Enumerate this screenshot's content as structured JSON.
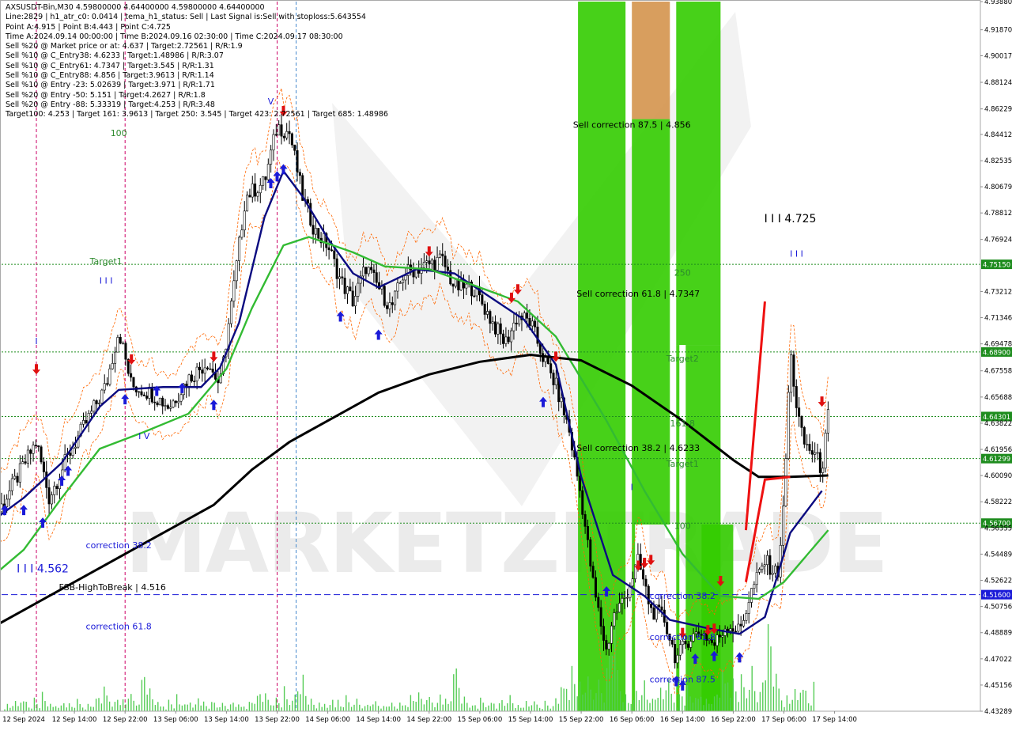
{
  "header": {
    "lines": [
      "AXSUSDT-Bin,M30  4.59800000 4.64400000 4.59800000 4.64400000",
      "Line:2829  |  h1_atr_c0: 0.0414  |  tema_h1_status: Sell  |  Last Signal is:Sell with stoploss:5.643554",
      "Point A:4.915  |  Point B:4.443  |  Point C:4.725",
      "Time A:2024.09.14 00:00:00  |  Time B:2024.09.16 02:30:00  |  Time C:2024.09.17 08:30:00",
      "Sell %20 @ Market price or at: 4.637  |  Target:2.72561  |  R/R:1.9",
      "Sell %10 @ C_Entry38: 4.6233  |  Target:1.48986  |  R/R:3.07",
      "Sell %10 @ C_Entry61: 4.7347  |  Target:3.545  |  R/R:1.31",
      "Sell %10 @ C_Entry88: 4.856  |  Target:3.9613  |  R/R:1.14",
      "Sell %10 @ Entry -23: 5.02639  |  Target:3.971  |  R/R:1.71",
      "Sell %20 @ Entry -50: 5.151  |  Target:4.2627  |  R/R:1.8",
      "Sell %20 @ Entry -88: 5.33319  |  Target:4.253  |  R/R:3.48",
      "Target100: 4.253  |  Target 161: 3.9613  |  Target 250: 3.545  |  Target 423: 2.72561  |  Target 685: 1.48986"
    ]
  },
  "chart_data": {
    "type": "candlestick",
    "symbol": "AXSUSDT-Bin",
    "timeframe": "M30",
    "ylim": [
      4.4329,
      4.9388
    ],
    "y_ticks": [
      "4.93880",
      "4.91870",
      "4.90017",
      "4.88124",
      "4.86229",
      "4.84412",
      "4.82535",
      "4.80679",
      "4.78812",
      "4.76924",
      "4.75150",
      "4.73212",
      "4.71346",
      "4.69478",
      "4.68900",
      "4.67558",
      "4.65688",
      "4.64301",
      "4.63822",
      "4.61956",
      "4.61299",
      "4.60090",
      "4.58222",
      "4.56700",
      "4.56355",
      "4.54489",
      "4.52622",
      "4.51600",
      "4.50756",
      "4.48889",
      "4.47022",
      "4.45156",
      "4.43289"
    ],
    "x_ticks": [
      "12 Sep 2024",
      "12 Sep 14:00",
      "12 Sep 22:00",
      "13 Sep 06:00",
      "13 Sep 14:00",
      "13 Sep 22:00",
      "14 Sep 06:00",
      "14 Sep 14:00",
      "14 Sep 22:00",
      "15 Sep 06:00",
      "15 Sep 14:00",
      "15 Sep 22:00",
      "16 Sep 06:00",
      "16 Sep 14:00",
      "16 Sep 22:00",
      "17 Sep 06:00",
      "17 Sep 14:00"
    ],
    "level_lines": [
      {
        "value": 4.7515,
        "label": "4.75150",
        "color": "#1e8c1e",
        "style": "dotted"
      },
      {
        "value": 4.689,
        "label": "4.68900",
        "color": "#1e8c1e",
        "style": "dotted"
      },
      {
        "value": 4.643,
        "label": "4.64301",
        "color": "#1e8c1e",
        "style": "dotted"
      },
      {
        "value": 4.613,
        "label": "4.61299",
        "color": "#1e8c1e",
        "style": "dotted"
      },
      {
        "value": 4.567,
        "label": "4.56700",
        "color": "#1e8c1e",
        "style": "dotted"
      },
      {
        "value": 4.516,
        "label": "4.51600",
        "color": "#1a1ad8",
        "style": "dashed"
      }
    ],
    "annotations": [
      {
        "text": "100",
        "x": "12 Sep 21:00",
        "y": 4.843,
        "color": "#2d8a2d"
      },
      {
        "text": "Target1",
        "x": "12 Sep 19:00",
        "y": 4.7516,
        "color": "#2d8a2d"
      },
      {
        "text": "I I I",
        "x": "12 Sep 19:00",
        "y": 4.7376,
        "color": "#1a1ad8"
      },
      {
        "text": "V",
        "x": "13 Sep 21:00",
        "y": 4.8655,
        "color": "#1a1ad8"
      },
      {
        "text": "I",
        "x": "12 Sep 08:00",
        "y": 4.6946,
        "color": "#1a1ad8"
      },
      {
        "text": "I V",
        "x": "13 Sep 01:00",
        "y": 4.6268,
        "color": "#1a1ad8"
      },
      {
        "text": "correction 38.2",
        "x": "12 Sep 21:00",
        "y": 4.549,
        "color": "#1a1ad8"
      },
      {
        "text": "I I I 4.562",
        "x": "12 Sep 09:00",
        "y": 4.5319,
        "color": "#1a1ad8"
      },
      {
        "text": "FSB-HighToBreak  |  4.516",
        "x": "12 Sep 20:00",
        "y": 4.5191,
        "color": "#000000"
      },
      {
        "text": "correction 61.8",
        "x": "12 Sep 21:00",
        "y": 4.4913,
        "color": "#1a1ad8"
      },
      {
        "text": "Sell correction 87.5 | 4.856",
        "x": "16 Sep 06:00",
        "y": 4.8489,
        "color": "#000000"
      },
      {
        "text": "Sell correction 61.8 | 4.7347",
        "x": "16 Sep 07:00",
        "y": 4.7283,
        "color": "#000000"
      },
      {
        "text": "Sell correction 38.2 | 4.6233",
        "x": "16 Sep 07:00",
        "y": 4.6184,
        "color": "#000000"
      },
      {
        "text": "I I I 4.725",
        "x": "17 Sep 07:00",
        "y": 4.7814,
        "color": "#000000"
      },
      {
        "text": "I I I",
        "x": "17 Sep 08:00",
        "y": 4.7569,
        "color": "#1a1ad8"
      },
      {
        "text": "250",
        "x": "16 Sep 14:00",
        "y": 4.7435,
        "color": "#2d8a2d"
      },
      {
        "text": "Target2",
        "x": "16 Sep 14:00",
        "y": 4.6821,
        "color": "#2d8a2d"
      },
      {
        "text": "161.8",
        "x": "16 Sep 14:00",
        "y": 4.636,
        "color": "#2d8a2d"
      },
      {
        "text": "Target1",
        "x": "16 Sep 14:00",
        "y": 4.6072,
        "color": "#2d8a2d"
      },
      {
        "text": "I",
        "x": "16 Sep 06:00",
        "y": 4.5906,
        "color": "#1a1ad8"
      },
      {
        "text": "100",
        "x": "16 Sep 14:00",
        "y": 4.5628,
        "color": "#2d8a2d"
      },
      {
        "text": "correction 38.2",
        "x": "16 Sep 14:00",
        "y": 4.5129,
        "color": "#1a1ad8"
      },
      {
        "text": "correction 61.8",
        "x": "16 Sep 14:00",
        "y": 4.4837,
        "color": "#1a1ad8"
      },
      {
        "text": "correction 87.5",
        "x": "16 Sep 14:00",
        "y": 4.4535,
        "color": "#1a1ad8"
      }
    ],
    "zones": [
      {
        "from": "15 Sep 21:30",
        "to": "16 Sep 05:00",
        "y0": 4.4329,
        "y1": 4.9388,
        "color": "#33cc00"
      },
      {
        "from": "16 Sep 06:00",
        "to": "16 Sep 12:00",
        "y0": 4.855,
        "y1": 4.9388,
        "color": "#d4944c"
      },
      {
        "from": "16 Sep 06:00",
        "to": "16 Sep 12:00",
        "y0": 4.566,
        "y1": 4.855,
        "color": "#33cc00"
      },
      {
        "from": "16 Sep 13:00",
        "to": "16 Sep 20:00",
        "y0": 4.694,
        "y1": 4.9388,
        "color": "#33cc00"
      },
      {
        "from": "16 Sep 13:00",
        "to": "16 Sep 13:30",
        "y0": 4.4329,
        "y1": 4.694,
        "color": "#33cc00"
      },
      {
        "from": "16 Sep 14:30",
        "to": "16 Sep 20:00",
        "y0": 4.4329,
        "y1": 4.694,
        "color": "#33cc00"
      },
      {
        "from": "16 Sep 06:00",
        "to": "16 Sep 06:30",
        "y0": 4.4329,
        "y1": 4.566,
        "color": "#33cc00"
      },
      {
        "from": "16 Sep 17:00",
        "to": "16 Sep 22:00",
        "y0": 4.4329,
        "y1": 4.566,
        "color": "#33cc00"
      }
    ],
    "series": [
      {
        "name": "",
        "color": "#0a0a80",
        "values": [
          [
            "12 Sep 00:00",
            4.565
          ],
          [
            "12 Sep 06:00",
            4.585
          ],
          [
            "12 Sep 12:00",
            4.61
          ],
          [
            "12 Sep 18:00",
            4.65
          ],
          [
            "12 Sep 21:00",
            4.662
          ],
          [
            "13 Sep 04:00",
            4.664
          ],
          [
            "13 Sep 10:00",
            4.664
          ],
          [
            "13 Sep 13:00",
            4.678
          ],
          [
            "13 Sep 16:00",
            4.71
          ],
          [
            "13 Sep 20:00",
            4.785
          ],
          [
            "13 Sep 23:00",
            4.818
          ],
          [
            "14 Sep 02:00",
            4.8
          ],
          [
            "14 Sep 06:00",
            4.77
          ],
          [
            "14 Sep 10:00",
            4.745
          ],
          [
            "14 Sep 14:00",
            4.735
          ],
          [
            "14 Sep 20:00",
            4.748
          ],
          [
            "15 Sep 02:00",
            4.745
          ],
          [
            "15 Sep 08:00",
            4.727
          ],
          [
            "15 Sep 13:00",
            4.712
          ],
          [
            "15 Sep 18:00",
            4.68
          ],
          [
            "15 Sep 22:00",
            4.6
          ],
          [
            "16 Sep 03:00",
            4.53
          ],
          [
            "16 Sep 08:00",
            4.515
          ],
          [
            "16 Sep 12:00",
            4.498
          ],
          [
            "16 Sep 18:00",
            4.492
          ],
          [
            "16 Sep 23:00",
            4.488
          ],
          [
            "17 Sep 03:00",
            4.5
          ],
          [
            "17 Sep 07:00",
            4.56
          ],
          [
            "17 Sep 12:00",
            4.59
          ]
        ]
      },
      {
        "name": "",
        "color": "#33bb33",
        "values": [
          [
            "12 Sep 00:00",
            4.525
          ],
          [
            "12 Sep 06:00",
            4.548
          ],
          [
            "12 Sep 12:00",
            4.585
          ],
          [
            "12 Sep 18:00",
            4.62
          ],
          [
            "13 Sep 01:00",
            4.632
          ],
          [
            "13 Sep 08:00",
            4.645
          ],
          [
            "13 Sep 14:00",
            4.677
          ],
          [
            "13 Sep 18:00",
            4.72
          ],
          [
            "13 Sep 23:00",
            4.765
          ],
          [
            "14 Sep 03:00",
            4.771
          ],
          [
            "14 Sep 10:00",
            4.76
          ],
          [
            "14 Sep 15:00",
            4.75
          ],
          [
            "14 Sep 22:00",
            4.748
          ],
          [
            "15 Sep 06:00",
            4.735
          ],
          [
            "15 Sep 12:00",
            4.725
          ],
          [
            "15 Sep 18:00",
            4.7
          ],
          [
            "16 Sep 02:00",
            4.64
          ],
          [
            "16 Sep 08:00",
            4.59
          ],
          [
            "16 Sep 14:00",
            4.545
          ],
          [
            "16 Sep 20:00",
            4.515
          ],
          [
            "17 Sep 02:00",
            4.513
          ],
          [
            "17 Sep 06:00",
            4.525
          ],
          [
            "17 Sep 13:00",
            4.562
          ]
        ]
      },
      {
        "name": "",
        "color": "#000000",
        "values": [
          [
            "12 Sep 00:00",
            4.49
          ],
          [
            "12 Sep 06:00",
            4.505
          ],
          [
            "12 Sep 12:00",
            4.52
          ],
          [
            "12 Sep 18:00",
            4.535
          ],
          [
            "13 Sep 00:00",
            4.55
          ],
          [
            "13 Sep 06:00",
            4.565
          ],
          [
            "13 Sep 12:00",
            4.58
          ],
          [
            "13 Sep 18:00",
            4.605
          ],
          [
            "14 Sep 00:00",
            4.625
          ],
          [
            "14 Sep 08:00",
            4.645
          ],
          [
            "14 Sep 14:00",
            4.66
          ],
          [
            "14 Sep 22:00",
            4.673
          ],
          [
            "15 Sep 06:00",
            4.682
          ],
          [
            "15 Sep 14:00",
            4.687
          ],
          [
            "15 Sep 22:00",
            4.683
          ],
          [
            "16 Sep 06:00",
            4.665
          ],
          [
            "16 Sep 14:00",
            4.64
          ],
          [
            "16 Sep 22:00",
            4.612
          ],
          [
            "17 Sep 02:00",
            4.6
          ],
          [
            "17 Sep 07:00",
            4.6
          ],
          [
            "17 Sep 13:00",
            4.601
          ]
        ]
      }
    ],
    "price": [
      [
        "12 Sep 00:00",
        4.59
      ],
      [
        "12 Sep 02:00",
        4.575
      ],
      [
        "12 Sep 05:00",
        4.6
      ],
      [
        "12 Sep 08:00",
        4.625
      ],
      [
        "12 Sep 10:00",
        4.585
      ],
      [
        "12 Sep 13:00",
        4.615
      ],
      [
        "12 Sep 16:00",
        4.64
      ],
      [
        "12 Sep 19:00",
        4.665
      ],
      [
        "12 Sep 21:00",
        4.705
      ],
      [
        "12 Sep 23:00",
        4.665
      ],
      [
        "13 Sep 02:00",
        4.66
      ],
      [
        "13 Sep 05:00",
        4.65
      ],
      [
        "13 Sep 08:00",
        4.67
      ],
      [
        "13 Sep 11:00",
        4.682
      ],
      [
        "13 Sep 13:00",
        4.665
      ],
      [
        "13 Sep 15:00",
        4.73
      ],
      [
        "13 Sep 17:00",
        4.8
      ],
      [
        "13 Sep 20:00",
        4.81
      ],
      [
        "13 Sep 22:00",
        4.85
      ],
      [
        "14 Sep 00:00",
        4.845
      ],
      [
        "14 Sep 02:00",
        4.8
      ],
      [
        "14 Sep 04:00",
        4.775
      ],
      [
        "14 Sep 06:00",
        4.765
      ],
      [
        "14 Sep 08:00",
        4.74
      ],
      [
        "14 Sep 10:00",
        4.725
      ],
      [
        "14 Sep 12:00",
        4.75
      ],
      [
        "14 Sep 14:00",
        4.735
      ],
      [
        "14 Sep 16:00",
        4.72
      ],
      [
        "14 Sep 18:00",
        4.745
      ],
      [
        "14 Sep 21:00",
        4.75
      ],
      [
        "15 Sep 00:00",
        4.755
      ],
      [
        "15 Sep 02:00",
        4.735
      ],
      [
        "15 Sep 05:00",
        4.735
      ],
      [
        "15 Sep 08:00",
        4.71
      ],
      [
        "15 Sep 10:00",
        4.695
      ],
      [
        "15 Sep 12:00",
        4.715
      ],
      [
        "15 Sep 14:00",
        4.71
      ],
      [
        "15 Sep 16:00",
        4.685
      ],
      [
        "15 Sep 18:00",
        4.665
      ],
      [
        "15 Sep 20:00",
        4.635
      ],
      [
        "15 Sep 22:00",
        4.585
      ],
      [
        "16 Sep 00:00",
        4.52
      ],
      [
        "16 Sep 02:00",
        4.475
      ],
      [
        "16 Sep 03:00",
        4.5
      ],
      [
        "16 Sep 05:00",
        4.515
      ],
      [
        "16 Sep 07:00",
        4.54
      ],
      [
        "16 Sep 09:00",
        4.505
      ],
      [
        "16 Sep 11:00",
        4.5
      ],
      [
        "16 Sep 13:00",
        4.47
      ],
      [
        "16 Sep 15:00",
        4.485
      ],
      [
        "16 Sep 17:00",
        4.49
      ],
      [
        "16 Sep 19:00",
        4.48
      ],
      [
        "16 Sep 21:00",
        4.495
      ],
      [
        "16 Sep 23:00",
        4.49
      ],
      [
        "17 Sep 01:00",
        4.52
      ],
      [
        "17 Sep 03:00",
        4.54
      ],
      [
        "17 Sep 05:00",
        4.53
      ],
      [
        "17 Sep 06:00",
        4.58
      ],
      [
        "17 Sep 07:00",
        4.69
      ],
      [
        "17 Sep 08:00",
        4.65
      ],
      [
        "17 Sep 09:00",
        4.625
      ],
      [
        "17 Sep 11:00",
        4.615
      ],
      [
        "17 Sep 12:00",
        4.605
      ],
      [
        "17 Sep 13:00",
        4.644
      ]
    ],
    "sell_arrows": [
      [
        "12 Sep 00:00",
        4.593
      ],
      [
        "12 Sep 08:00",
        4.673
      ],
      [
        "12 Sep 23:00",
        4.68
      ],
      [
        "13 Sep 12:00",
        4.682
      ],
      [
        "13 Sep 23:00",
        4.857
      ],
      [
        "14 Sep 22:00",
        4.757
      ],
      [
        "15 Sep 11:00",
        4.724
      ],
      [
        "15 Sep 12:00",
        4.73
      ],
      [
        "15 Sep 18:00",
        4.682
      ],
      [
        "16 Sep 07:00",
        4.533
      ],
      [
        "16 Sep 08:00",
        4.535
      ],
      [
        "16 Sep 09:00",
        4.537
      ],
      [
        "16 Sep 14:00",
        4.485
      ],
      [
        "16 Sep 18:00",
        4.487
      ],
      [
        "16 Sep 19:00",
        4.488
      ],
      [
        "16 Sep 20:00",
        4.522
      ],
      [
        "17 Sep 12:00",
        4.65
      ]
    ],
    "buy_arrows": [
      [
        "12 Sep 00:00",
        4.577
      ],
      [
        "12 Sep 03:00",
        4.58
      ],
      [
        "12 Sep 06:00",
        4.58
      ],
      [
        "12 Sep 09:00",
        4.571
      ],
      [
        "12 Sep 12:00",
        4.601
      ],
      [
        "12 Sep 13:00",
        4.608
      ],
      [
        "12 Sep 22:00",
        4.659
      ],
      [
        "13 Sep 03:00",
        4.665
      ],
      [
        "13 Sep 07:00",
        4.667
      ],
      [
        "13 Sep 12:00",
        4.655
      ],
      [
        "13 Sep 21:00",
        4.813
      ],
      [
        "13 Sep 22:00",
        4.818
      ],
      [
        "13 Sep 23:00",
        4.823
      ],
      [
        "14 Sep 08:00",
        4.718
      ],
      [
        "14 Sep 14:00",
        4.705
      ],
      [
        "15 Sep 16:00",
        4.657
      ],
      [
        "16 Sep 02:00",
        4.522
      ],
      [
        "16 Sep 13:00",
        4.458
      ],
      [
        "16 Sep 14:00",
        4.455
      ],
      [
        "16 Sep 16:00",
        4.474
      ],
      [
        "16 Sep 19:00",
        4.476
      ],
      [
        "16 Sep 23:00",
        4.475
      ]
    ],
    "red_lines": [
      [
        [
          "17 Sep 00:00",
          4.562
        ],
        [
          "17 Sep 03:00",
          4.725
        ]
      ],
      [
        [
          "17 Sep 00:00",
          4.525
        ],
        [
          "17 Sep 03:00",
          4.598
        ],
        [
          "17 Sep 07:00",
          4.6
        ]
      ]
    ],
    "vertical_lines": [
      {
        "time": "12 Sep 08:00",
        "color": "#cc0066"
      },
      {
        "time": "12 Sep 22:00",
        "color": "#cc0066"
      },
      {
        "time": "13 Sep 22:00",
        "color": "#cc0066"
      },
      {
        "time": "14 Sep 01:00",
        "color": "#4488cc"
      }
    ],
    "watermark": "MARKETZITRADE"
  },
  "colors": {
    "background": "#ffffff",
    "axis_label_green": "#1e8c1e",
    "axis_label_blue": "#1a1ad8",
    "bull_candle": "#ffffff",
    "bear_candle": "#000000",
    "volume": "#55cc55",
    "envelope": "#ff6600"
  }
}
